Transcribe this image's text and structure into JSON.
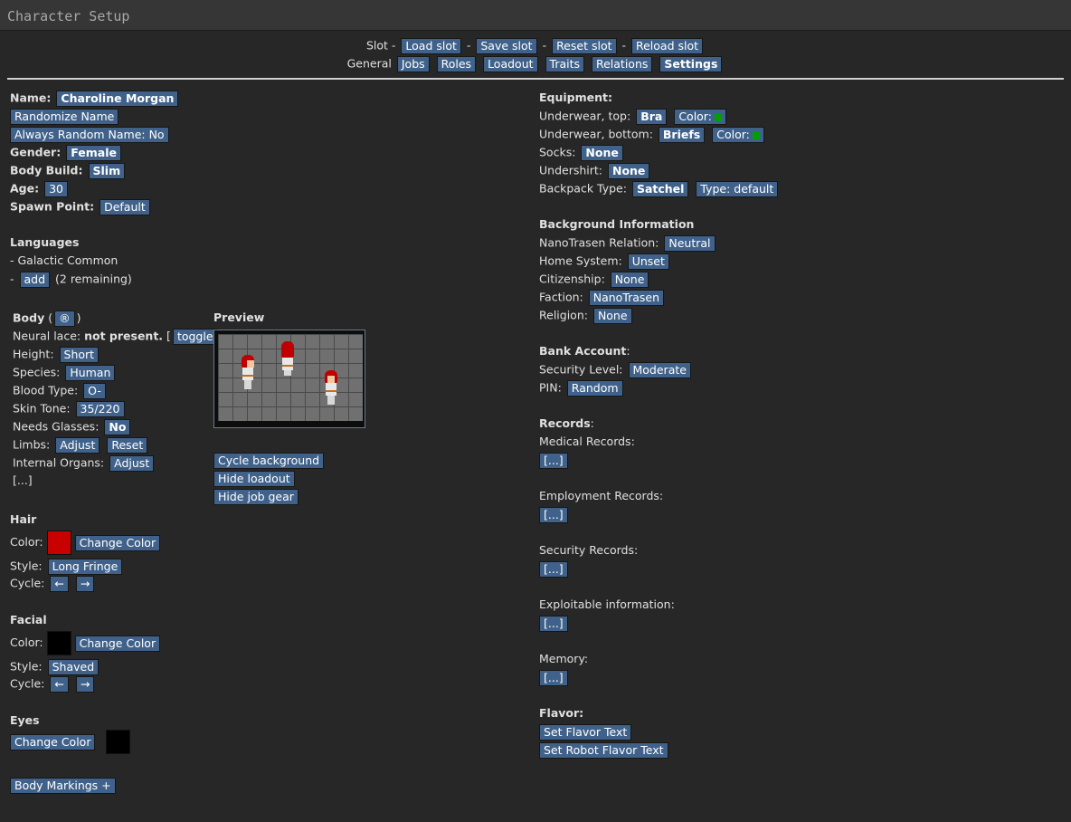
{
  "window": {
    "title": "Character Setup"
  },
  "slot_nav": {
    "label": "Slot -",
    "dash": "-",
    "buttons": [
      "Load slot",
      "Save slot",
      "Reset slot",
      "Reload slot"
    ]
  },
  "tab_nav": {
    "label": "General",
    "tabs": [
      "Jobs",
      "Roles",
      "Loadout",
      "Traits",
      "Relations",
      "Settings"
    ],
    "selected": "Settings"
  },
  "identity": {
    "name_label": "Name:",
    "name": "Charoline Morgan",
    "randomize_name": "Randomize Name",
    "always_random": "Always Random Name: No",
    "gender_label": "Gender:",
    "gender": "Female",
    "build_label": "Body Build:",
    "build": "Slim",
    "age_label": "Age:",
    "age": "30",
    "spawn_label": "Spawn Point:",
    "spawn": "Default"
  },
  "languages": {
    "title": "Languages",
    "known": "- Galactic Common",
    "dash": "-",
    "add": "add",
    "remaining": "(2 remaining)"
  },
  "body": {
    "title": "Body",
    "paren_open": "(",
    "random_glyph": "®",
    "paren_close": ")",
    "lace_label": "Neural lace:",
    "lace_value": "not present.",
    "lace_open": "[",
    "lace_toggle": "toggle",
    "lace_close": "]",
    "height_label": "Height:",
    "height": "Short",
    "species_label": "Species:",
    "species": "Human",
    "blood_label": "Blood Type:",
    "blood": "O-",
    "skin_label": "Skin Tone:",
    "skin": "35/220",
    "glasses_label": "Needs Glasses:",
    "glasses": "No",
    "limbs_label": "Limbs:",
    "limbs_adjust": "Adjust",
    "limbs_reset": "Reset",
    "organs_label": "Internal Organs:",
    "organs_adjust": "Adjust",
    "more": "[...]"
  },
  "preview": {
    "title": "Preview",
    "cycle_background": "Cycle background",
    "hide_loadout": "Hide loadout",
    "hide_job_gear": "Hide job gear"
  },
  "hair": {
    "title": "Hair",
    "color_label": "Color:",
    "color": "#c80000",
    "change_color": "Change Color",
    "style_label": "Style:",
    "style": "Long Fringe",
    "cycle_label": "Cycle:",
    "prev": "←",
    "next": "→"
  },
  "facial": {
    "title": "Facial",
    "color_label": "Color:",
    "color": "#000000",
    "change_color": "Change Color",
    "style_label": "Style:",
    "style": "Shaved",
    "cycle_label": "Cycle:",
    "prev": "←",
    "next": "→"
  },
  "eyes": {
    "title": "Eyes",
    "change_color": "Change Color",
    "color": "#000000"
  },
  "body_markings": "Body Markings +",
  "equipment": {
    "title": "Equipment:",
    "uw_top_label": "Underwear, top:",
    "uw_top": "Bra",
    "uw_top_color": "Color:",
    "uw_bottom_label": "Underwear, bottom:",
    "uw_bottom": "Briefs",
    "uw_bottom_color": "Color:",
    "socks_label": "Socks:",
    "socks": "None",
    "undershirt_label": "Undershirt:",
    "undershirt": "None",
    "backpack_label": "Backpack Type:",
    "backpack": "Satchel",
    "backpack_type": "Type: default",
    "swatch_color": "#00a000"
  },
  "background": {
    "title": "Background Information",
    "nt_label": "NanoTrasen Relation:",
    "nt": "Neutral",
    "home_label": "Home System:",
    "home": "Unset",
    "citizen_label": "Citizenship:",
    "citizen": "None",
    "faction_label": "Faction:",
    "faction": "NanoTrasen",
    "religion_label": "Religion:",
    "religion": "None"
  },
  "bank": {
    "title": "Bank Account",
    "colon": ":",
    "security_label": "Security Level:",
    "security": "Moderate",
    "pin_label": "PIN:",
    "pin": "Random"
  },
  "records": {
    "title": "Records",
    "colon": ":",
    "medical": "Medical Records:",
    "employment": "Employment Records:",
    "security": "Security Records:",
    "exploitable": "Exploitable information:",
    "memory": "Memory:",
    "more": "[...]"
  },
  "flavor": {
    "title": "Flavor:",
    "set_text": "Set Flavor Text",
    "set_robot": "Set Robot Flavor Text"
  }
}
